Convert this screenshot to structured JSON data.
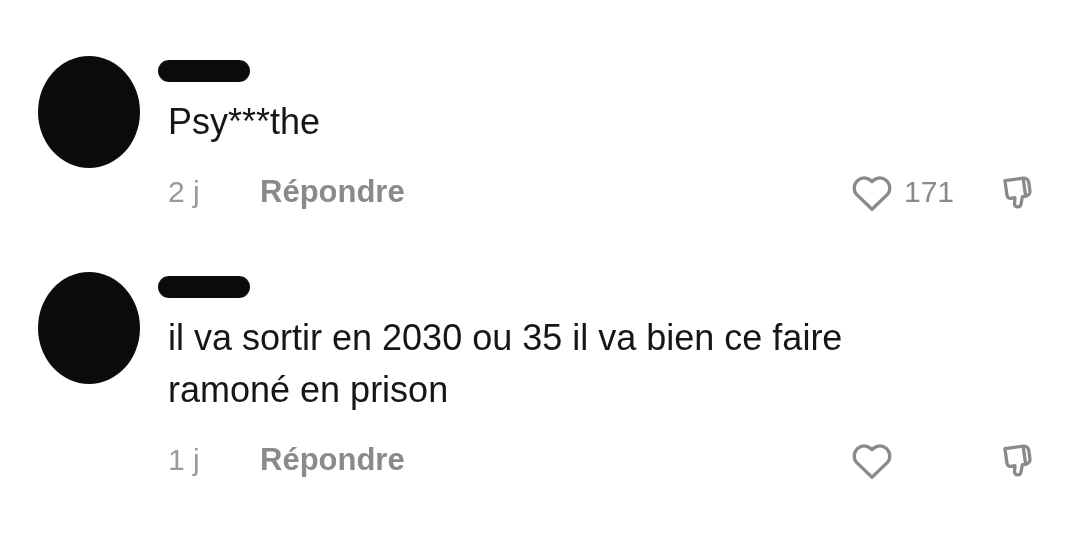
{
  "comments": [
    {
      "lines": [
        "Psy***the"
      ],
      "time": "2 j",
      "reply": "Répondre",
      "likes": "171",
      "liked": false
    },
    {
      "lines": [
        "il va sortir en 2030 ou 35 il va bien ce faire",
        "ramoné en prison"
      ],
      "time": "1 j",
      "reply": "Répondre",
      "liked": false
    }
  ]
}
